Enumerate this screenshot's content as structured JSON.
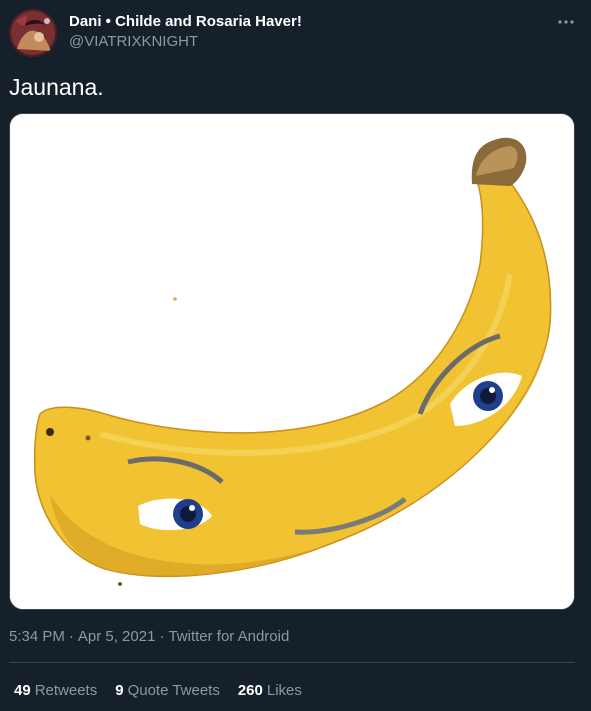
{
  "author": {
    "display_name": "Dani • Childe and Rosaria Haver!",
    "handle": "@VIATRIXKNIGHT"
  },
  "tweet": {
    "text": "Jaunana.",
    "time": "5:34 PM",
    "date": "Apr 5, 2021",
    "source": "Twitter for Android",
    "separator": "·"
  },
  "stats": {
    "retweets": {
      "count": "49",
      "label": "Retweets"
    },
    "quote_tweets": {
      "count": "9",
      "label": "Quote Tweets"
    },
    "likes": {
      "count": "260",
      "label": "Likes"
    }
  },
  "icons": {
    "more": "more-horizontal-icon"
  },
  "colors": {
    "background": "#15202b",
    "text_primary": "#ffffff",
    "text_secondary": "#8899a6",
    "divider": "#38444d",
    "banana": "#f1c232"
  }
}
